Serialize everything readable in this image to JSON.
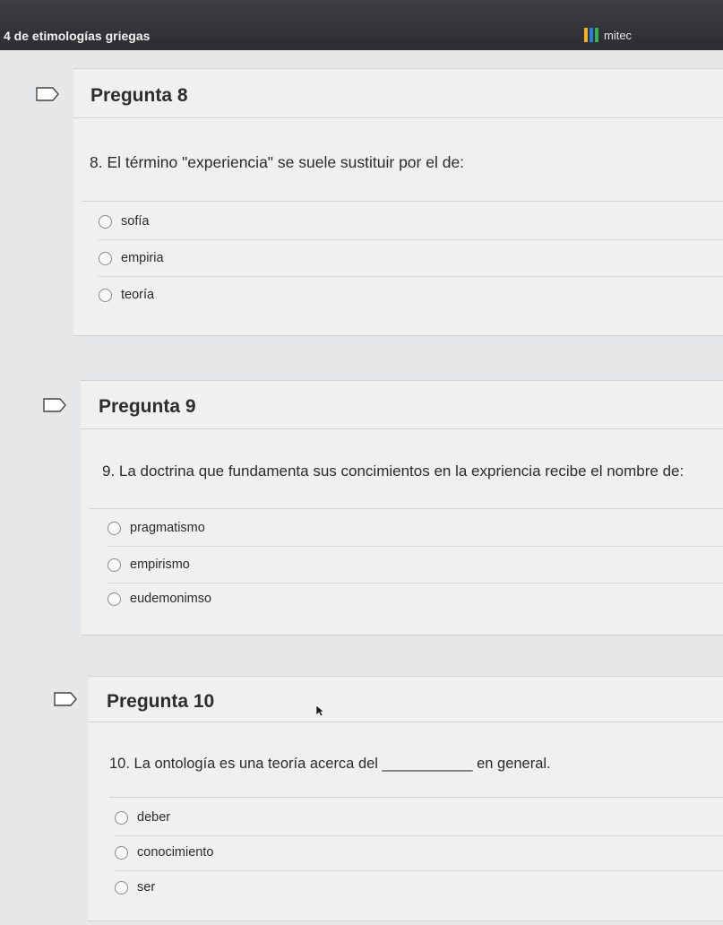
{
  "header": {
    "title": "4 de etimologías griegas",
    "brand": "mitec",
    "brand_colors": [
      "#f2b01e",
      "#2a7de1",
      "#35b34a"
    ]
  },
  "questions": [
    {
      "title": "Pregunta 8",
      "text": "8. El término \"experiencia\" se suele sustituir por el de:",
      "options": [
        "sofía",
        "empiria",
        "teoría"
      ]
    },
    {
      "title": "Pregunta 9",
      "text": "9. La doctrina que fundamenta sus concimientos en la expriencia recibe el nombre de:",
      "options": [
        "pragmatismo",
        "empirismo",
        "eudemonimso"
      ]
    },
    {
      "title": "Pregunta 10",
      "text": "10. La ontología es una teoría acerca del ___________ en general.",
      "options": [
        "deber",
        "conocimiento",
        "ser"
      ]
    }
  ]
}
